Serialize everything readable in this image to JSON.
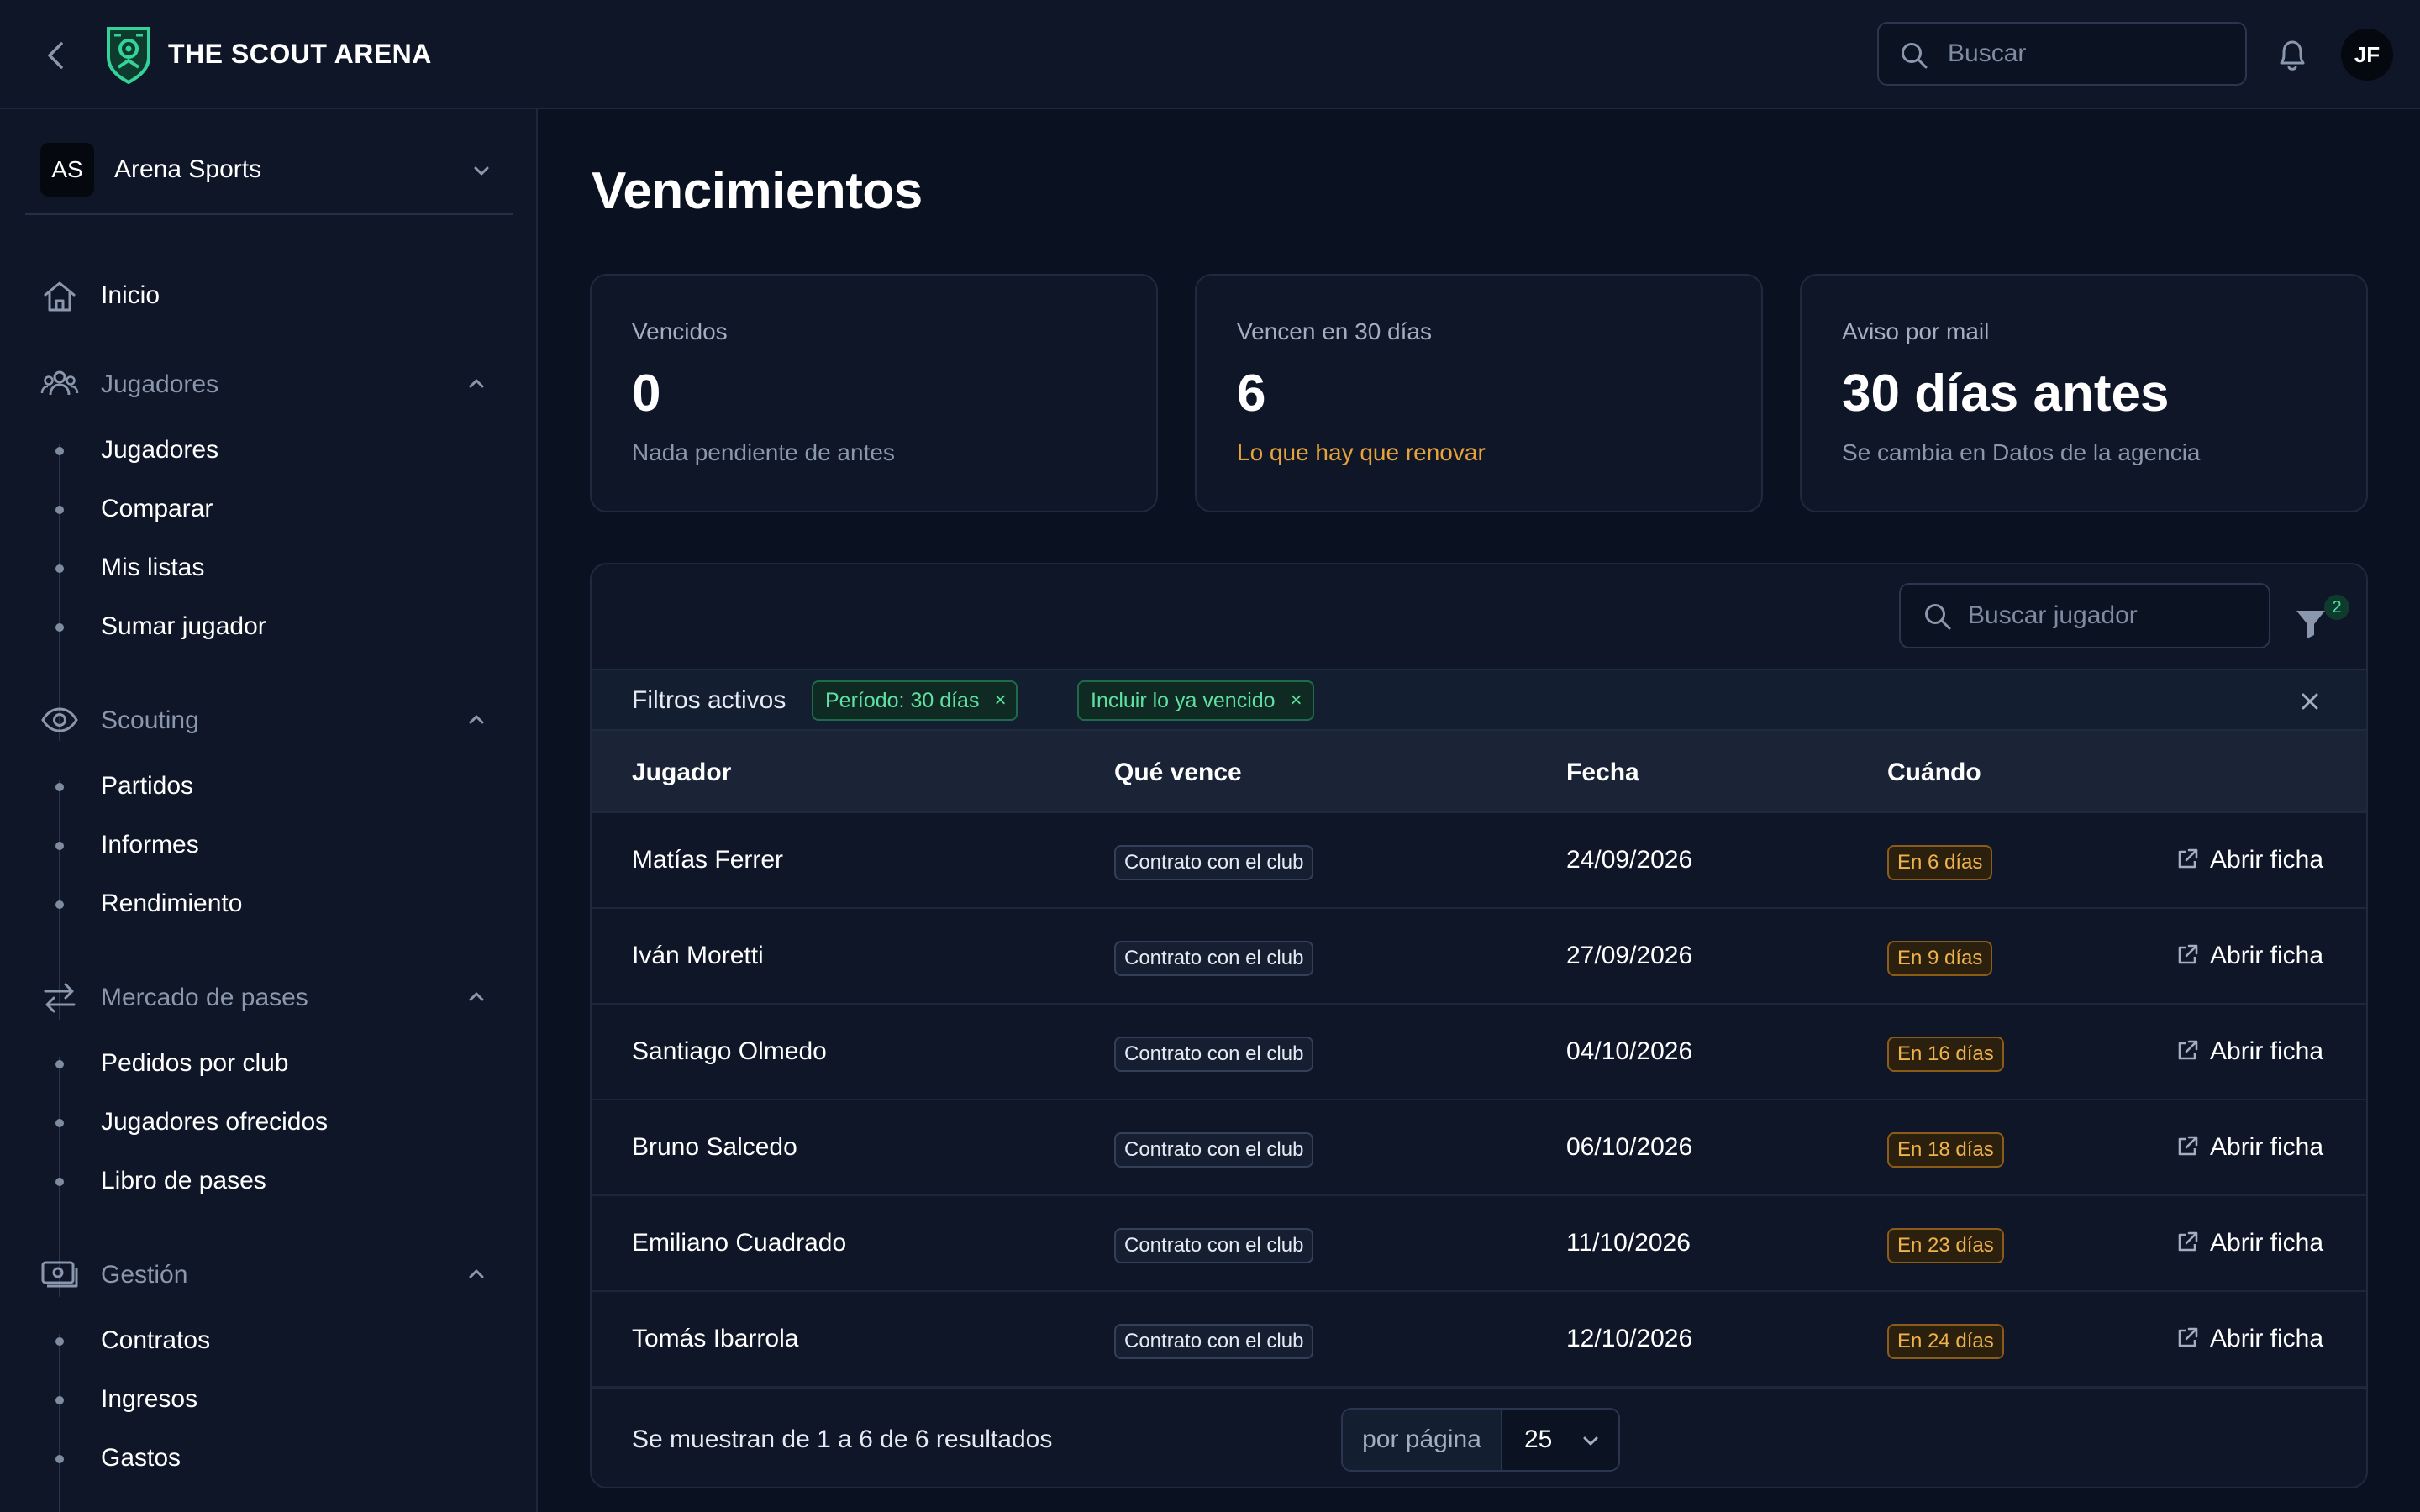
{
  "app": {
    "name": "THE SCOUT ARENA"
  },
  "header": {
    "search_placeholder": "Buscar",
    "avatar_initials": "JF"
  },
  "sidebar": {
    "org": {
      "initials": "AS",
      "name": "Arena Sports"
    },
    "home_label": "Inicio",
    "sections": [
      {
        "label": "Jugadores",
        "icon": "users-icon",
        "items": [
          "Jugadores",
          "Comparar",
          "Mis listas",
          "Sumar jugador"
        ]
      },
      {
        "label": "Scouting",
        "icon": "eye-icon",
        "items": [
          "Partidos",
          "Informes",
          "Rendimiento"
        ]
      },
      {
        "label": "Mercado de pases",
        "icon": "transfer-arrows-icon",
        "items": [
          "Pedidos por club",
          "Jugadores ofrecidos",
          "Libro de pases"
        ]
      },
      {
        "label": "Gestión",
        "icon": "money-icon",
        "items": [
          "Contratos",
          "Ingresos",
          "Gastos"
        ]
      }
    ]
  },
  "page": {
    "title": "Vencimientos"
  },
  "stats": [
    {
      "label": "Vencidos",
      "value": "0",
      "sub": "Nada pendiente de antes"
    },
    {
      "label": "Vencen en 30 días",
      "value": "6",
      "sub": "Lo que hay que renovar"
    },
    {
      "label": "Aviso por mail",
      "value": "30 días antes",
      "sub": "Se cambia en Datos de la agencia"
    }
  ],
  "table": {
    "search_placeholder": "Buscar jugador",
    "filter_count": "2",
    "active_filters_label": "Filtros activos",
    "chips": [
      "Período: 30 días",
      "Incluir lo ya vencido"
    ],
    "chip_remove": "×",
    "columns": [
      "Jugador",
      "Qué vence",
      "Fecha",
      "Cuándo"
    ],
    "open_label": "Abrir ficha",
    "rows": [
      {
        "player": "Matías Ferrer",
        "type": "Contrato con el club",
        "date": "24/09/2026",
        "when": "En 6 días"
      },
      {
        "player": "Iván Moretti",
        "type": "Contrato con el club",
        "date": "27/09/2026",
        "when": "En 9 días"
      },
      {
        "player": "Santiago Olmedo",
        "type": "Contrato con el club",
        "date": "04/10/2026",
        "when": "En 16 días"
      },
      {
        "player": "Bruno Salcedo",
        "type": "Contrato con el club",
        "date": "06/10/2026",
        "when": "En 18 días"
      },
      {
        "player": "Emiliano Cuadrado",
        "type": "Contrato con el club",
        "date": "11/10/2026",
        "when": "En 23 días"
      },
      {
        "player": "Tomás Ibarrola",
        "type": "Contrato con el club",
        "date": "12/10/2026",
        "when": "En 24 días"
      }
    ],
    "results_text": "Se muestran de 1 a 6 de 6 resultados",
    "per_page_label": "por página",
    "per_page_value": "25"
  },
  "colors": {
    "background": "#0a1120",
    "panel": "#0e1627",
    "accent_green": "#4ee0a0",
    "warning_amber": "#e7a33a"
  }
}
